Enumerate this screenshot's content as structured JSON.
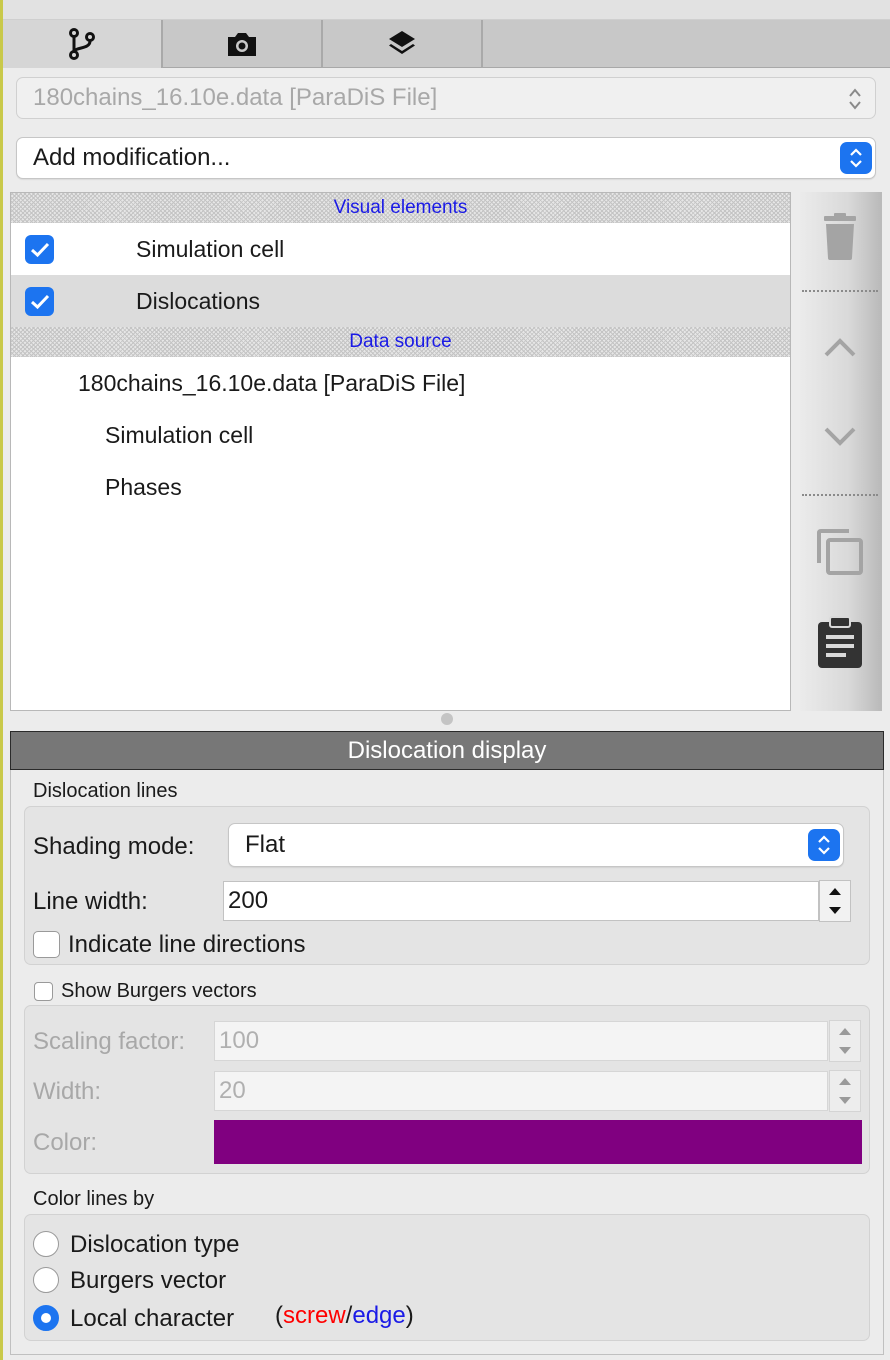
{
  "tabs": [
    {
      "icon": "pipeline-branch-icon",
      "active": true
    },
    {
      "icon": "camera-icon",
      "active": false
    },
    {
      "icon": "layers-icon",
      "active": false
    }
  ],
  "pipeline_selector": {
    "value": "180chains_16.10e.data [ParaDiS File]"
  },
  "add_modification": {
    "value": "Add modification..."
  },
  "pipeline": {
    "visual_header": "Visual elements",
    "visual_elements": [
      {
        "label": "Simulation cell",
        "checked": true,
        "selected": false
      },
      {
        "label": "Dislocations",
        "checked": true,
        "selected": true
      }
    ],
    "data_header": "Data source",
    "data_source": {
      "file": "180chains_16.10e.data [ParaDiS File]",
      "items": [
        "Simulation cell",
        "Phases"
      ]
    }
  },
  "toolbar": {
    "icons": [
      "delete-icon",
      "move-up-icon",
      "move-down-icon",
      "duplicate-icon",
      "paste-icon"
    ]
  },
  "panel": {
    "title": "Dislocation display",
    "lines_group": "Dislocation lines",
    "shading_label": "Shading mode:",
    "shading_value": "Flat",
    "line_width_label": "Line width:",
    "line_width_value": "200",
    "indicate_dirs_label": "Indicate line directions",
    "indicate_dirs_checked": false,
    "burgers_label": "Show Burgers vectors",
    "burgers_checked": false,
    "scaling_label": "Scaling factor:",
    "scaling_value": "100",
    "width_label": "Width:",
    "width_value": "20",
    "color_label": "Color:",
    "color_value": "#800080",
    "color_by_group": "Color lines by",
    "color_options": [
      "Dislocation type",
      "Burgers vector",
      "Local character"
    ],
    "selected_option": "Local character",
    "legend": {
      "open": "(",
      "screw": "screw",
      "slash": "/",
      "edge": "edge",
      "close": ")"
    },
    "legend_colors": {
      "screw": "#ff0000",
      "edge": "#1a1ae6"
    }
  },
  "colors": {
    "accent": "#1c74f0",
    "header_text": "#1a1ae6"
  }
}
